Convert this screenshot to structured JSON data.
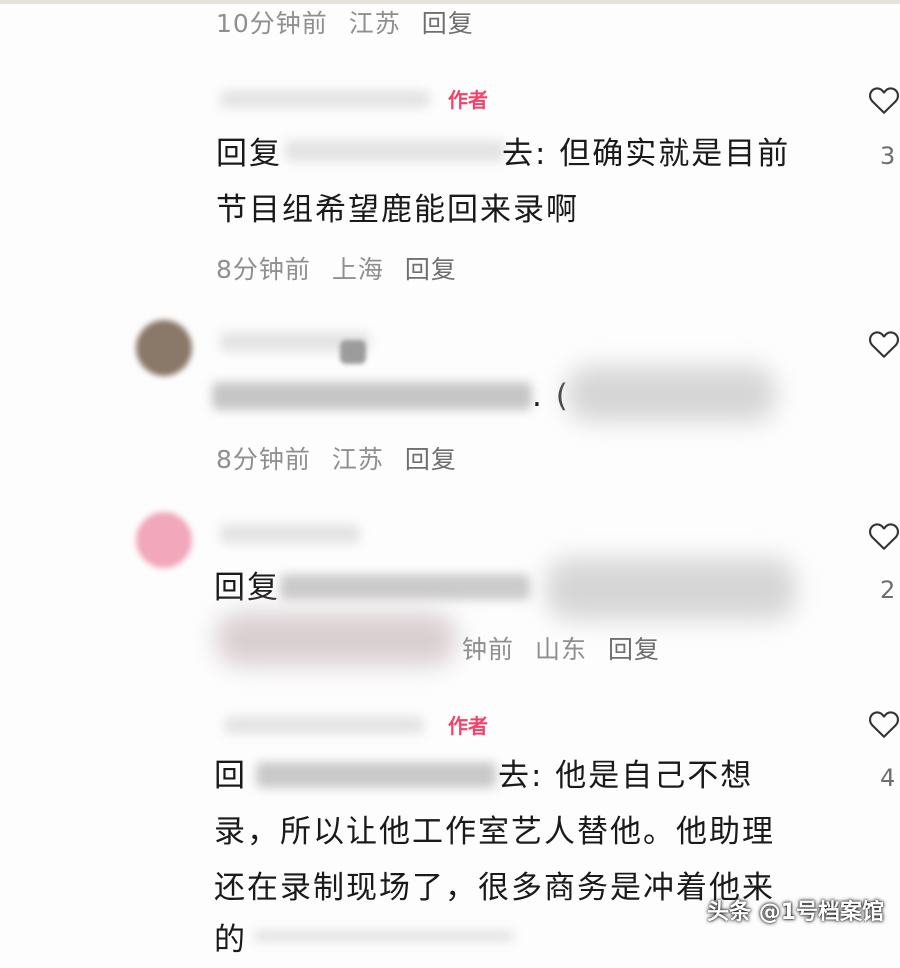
{
  "comments": [
    {
      "meta": {
        "time": "10分钟前",
        "location": "江苏",
        "reply": "回复"
      }
    },
    {
      "badge": "作者",
      "line1_prefix": "回复",
      "line1_text": "去: 但确实就是目前",
      "line2": "节目组希望鹿能回来录啊",
      "meta": {
        "time": "8分钟前",
        "location": "上海",
        "reply": "回复"
      },
      "like_count": "3"
    },
    {
      "line1_text": ". (",
      "meta": {
        "time": "8分钟前",
        "location": "江苏",
        "reply": "回复"
      }
    },
    {
      "line1_prefix": "回复",
      "meta": {
        "time": "钟前",
        "location": "山东",
        "reply": "回复"
      },
      "like_count": "2"
    },
    {
      "badge": "作者",
      "line1_prefix": "回",
      "line1_text": "去: 他是自己不想",
      "line2": "录，所以让他工作室艺人替他。他助理",
      "line3": "还在录制现场了，很多商务是冲着他来",
      "line4": "的",
      "like_count": "4"
    }
  ],
  "watermark": "头条 @1号档案馆",
  "colors": {
    "author_badge": "#f0426a",
    "meta_text": "#8f8f8f",
    "background": "#fdfdfd"
  },
  "icons": {
    "like": "heart-outline-icon"
  }
}
